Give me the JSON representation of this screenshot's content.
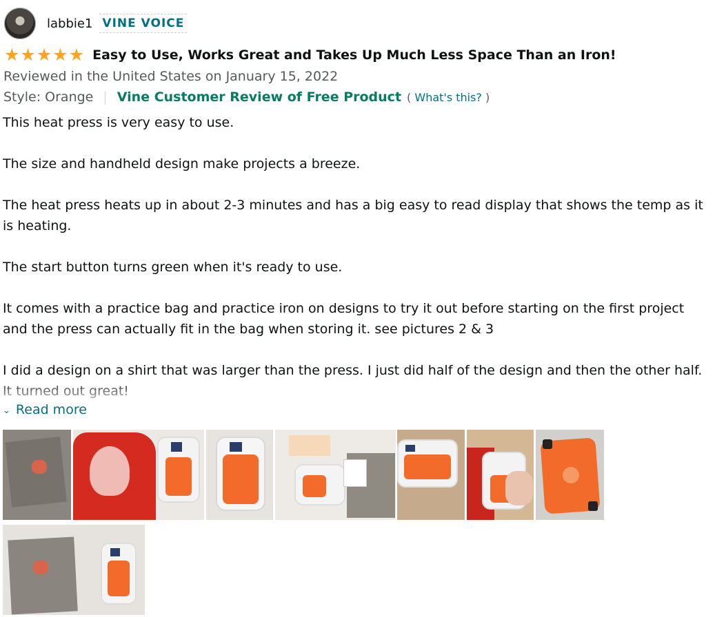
{
  "reviewer": {
    "name": "labbie1",
    "badge": "VINE VOICE"
  },
  "review": {
    "rating": 5,
    "rating_max": 5,
    "title": "Easy to Use, Works Great and Takes Up Much Less Space Than an Iron!",
    "reviewed_line": "Reviewed in the United States on January 15, 2022",
    "style": "Style: Orange",
    "vine_label": "Vine Customer Review of Free Product",
    "whats_this_open": "(",
    "whats_this": "What's this?",
    "whats_this_close": ")",
    "paragraphs": [
      "This heat press is very easy to use.",
      "The size and handheld design make projects a breeze.",
      "The heat press heats up in about 2-3 minutes and has a big easy to read display that shows the temp as it is heating.",
      "The start button turns green when it's ready to use.",
      "It comes with a practice bag and practice iron on designs to try it out before starting on the first project and the press can actually fit in the bag when storing it. see pictures 2 & 3",
      "I did a design on a shirt that was larger than the press. I just did half of the design and then the other half. It turned out great!"
    ],
    "read_more": "Read more"
  },
  "images": [
    {
      "subject": "gray bag with design"
    },
    {
      "subject": "red shirt with press"
    },
    {
      "subject": "heat press on table"
    },
    {
      "subject": "kit contents"
    },
    {
      "subject": "press with cord"
    },
    {
      "subject": "press on shirt with hand"
    },
    {
      "subject": "orange base of press"
    },
    {
      "subject": "bag and press"
    }
  ],
  "colors": {
    "star": "#ffa41c",
    "link": "#007185",
    "vine_green": "#067d62",
    "secondary_text": "#565959"
  }
}
